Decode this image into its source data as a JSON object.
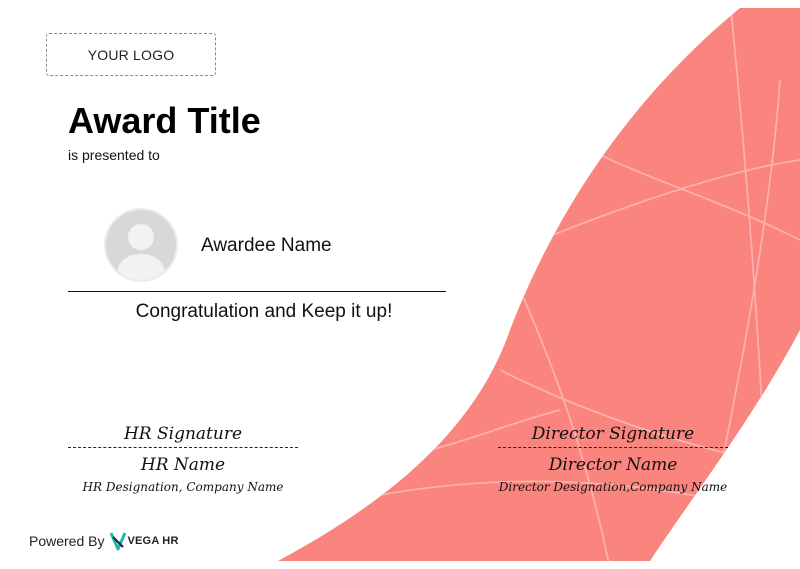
{
  "certificate": {
    "logo_placeholder": "YOUR LOGO",
    "award_title": "Award Title",
    "presented_text": "is presented to",
    "awardee_name": "Awardee Name",
    "message": "Congratulation and Keep it up!"
  },
  "signatures": {
    "left": {
      "signature": "HR Signature",
      "name": "HR Name",
      "designation": "HR Designation, Company Name"
    },
    "right": {
      "signature": "Director Signature",
      "name": "Director Name",
      "designation": "Director Designation,Company Name"
    }
  },
  "footer": {
    "powered_by": "Powered By",
    "brand_name": "VEGA HR"
  },
  "colors": {
    "accent": "#fa847e",
    "accent_lines": "#fbb1ac",
    "avatar_bg": "#d8d8d8",
    "avatar_figure": "#f2f2f2",
    "brand_teal": "#22b5b0",
    "brand_dark": "#1f2a44"
  },
  "icons": {
    "avatar": "user-silhouette-icon",
    "brand": "vega-hr-logo-icon"
  }
}
